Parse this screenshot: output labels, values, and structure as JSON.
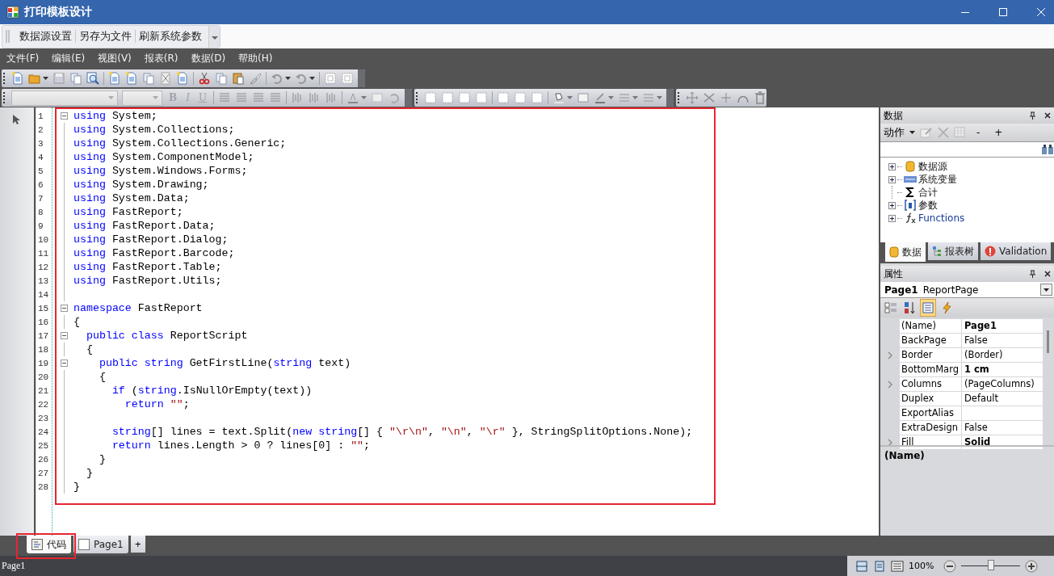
{
  "window": {
    "title": "打印模板设计"
  },
  "quick_toolbar": [
    "数据源设置",
    "另存为文件",
    "刷新系统参数"
  ],
  "menu": [
    "文件(F)",
    "编辑(E)",
    "视图(V)",
    "报表(R)",
    "数据(D)",
    "帮助(H)"
  ],
  "format_buttons": [
    {
      "label": "B",
      "disabled": true
    },
    {
      "label": "I",
      "disabled": true
    },
    {
      "label": "U",
      "disabled": true
    }
  ],
  "code_lines": [
    {
      "number": "1",
      "collapsible": true,
      "tokens": [
        {
          "kind": "keyword",
          "text": "using"
        },
        {
          "kind": "plain",
          "text": " System;"
        }
      ]
    },
    {
      "number": "2",
      "collapsible": false,
      "tokens": [
        {
          "kind": "keyword",
          "text": "using"
        },
        {
          "kind": "plain",
          "text": " System.Collections;"
        }
      ]
    },
    {
      "number": "3",
      "collapsible": false,
      "tokens": [
        {
          "kind": "keyword",
          "text": "using"
        },
        {
          "kind": "plain",
          "text": " System.Collections.Generic;"
        }
      ]
    },
    {
      "number": "4",
      "collapsible": false,
      "tokens": [
        {
          "kind": "keyword",
          "text": "using"
        },
        {
          "kind": "plain",
          "text": " System.ComponentModel;"
        }
      ]
    },
    {
      "number": "5",
      "collapsible": false,
      "tokens": [
        {
          "kind": "keyword",
          "text": "using"
        },
        {
          "kind": "plain",
          "text": " System.Windows.Forms;"
        }
      ]
    },
    {
      "number": "6",
      "collapsible": false,
      "tokens": [
        {
          "kind": "keyword",
          "text": "using"
        },
        {
          "kind": "plain",
          "text": " System.Drawing;"
        }
      ]
    },
    {
      "number": "7",
      "collapsible": false,
      "tokens": [
        {
          "kind": "keyword",
          "text": "using"
        },
        {
          "kind": "plain",
          "text": " System.Data;"
        }
      ]
    },
    {
      "number": "8",
      "collapsible": false,
      "tokens": [
        {
          "kind": "keyword",
          "text": "using"
        },
        {
          "kind": "plain",
          "text": " FastReport;"
        }
      ]
    },
    {
      "number": "9",
      "collapsible": false,
      "tokens": [
        {
          "kind": "keyword",
          "text": "using"
        },
        {
          "kind": "plain",
          "text": " FastReport.Data;"
        }
      ]
    },
    {
      "number": "10",
      "collapsible": false,
      "tokens": [
        {
          "kind": "keyword",
          "text": "using"
        },
        {
          "kind": "plain",
          "text": " FastReport.Dialog;"
        }
      ]
    },
    {
      "number": "11",
      "collapsible": false,
      "tokens": [
        {
          "kind": "keyword",
          "text": "using"
        },
        {
          "kind": "plain",
          "text": " FastReport.Barcode;"
        }
      ]
    },
    {
      "number": "12",
      "collapsible": false,
      "tokens": [
        {
          "kind": "keyword",
          "text": "using"
        },
        {
          "kind": "plain",
          "text": " FastReport.Table;"
        }
      ]
    },
    {
      "number": "13",
      "collapsible": false,
      "tokens": [
        {
          "kind": "keyword",
          "text": "using"
        },
        {
          "kind": "plain",
          "text": " FastReport.Utils;"
        }
      ]
    },
    {
      "number": "14",
      "collapsible": false
    },
    {
      "number": "15",
      "collapsible": true,
      "tokens": [
        {
          "kind": "keyword",
          "text": "namespace"
        },
        {
          "kind": "plain",
          "text": " FastReport"
        }
      ]
    },
    {
      "number": "16",
      "collapsible": false,
      "tokens": [
        {
          "kind": "plain",
          "text": "{"
        }
      ]
    },
    {
      "number": "17",
      "collapsible": true,
      "tokens": [
        {
          "kind": "keyword",
          "text": "  public class"
        },
        {
          "kind": "plain",
          "text": " ReportScript"
        }
      ]
    },
    {
      "number": "18",
      "collapsible": false,
      "tokens": [
        {
          "kind": "plain",
          "text": "  {"
        }
      ]
    },
    {
      "number": "19",
      "collapsible": true,
      "tokens": [
        {
          "kind": "keyword",
          "text": "    public string"
        },
        {
          "kind": "plain",
          "text": " GetFirstLine("
        },
        {
          "kind": "keyword",
          "text": "string"
        },
        {
          "kind": "plain",
          "text": " text)"
        }
      ]
    },
    {
      "number": "20",
      "collapsible": false,
      "tokens": [
        {
          "kind": "plain",
          "text": "    {"
        }
      ]
    },
    {
      "number": "21",
      "collapsible": false,
      "tokens": [
        {
          "kind": "keyword",
          "text": "      if"
        },
        {
          "kind": "plain",
          "text": " ("
        },
        {
          "kind": "keyword",
          "text": "string"
        },
        {
          "kind": "plain",
          "text": ".IsNullOrEmpty(text))"
        }
      ]
    },
    {
      "number": "22",
      "collapsible": false,
      "tokens": [
        {
          "kind": "keyword",
          "text": "        return "
        },
        {
          "kind": "string",
          "text": "\"\""
        },
        {
          "kind": "plain",
          "text": ";"
        }
      ]
    },
    {
      "number": "23",
      "collapsible": false
    },
    {
      "number": "24",
      "collapsible": false,
      "tokens": [
        {
          "kind": "keyword",
          "text": "      string"
        },
        {
          "kind": "plain",
          "text": "[] lines = text.Split("
        },
        {
          "kind": "keyword",
          "text": "new string"
        },
        {
          "kind": "plain",
          "text": "[] { "
        },
        {
          "kind": "string",
          "text": "\"\\r\\n\""
        },
        {
          "kind": "plain",
          "text": ", "
        },
        {
          "kind": "string",
          "text": "\"\\n\""
        },
        {
          "kind": "plain",
          "text": ", "
        },
        {
          "kind": "string",
          "text": "\"\\r\""
        },
        {
          "kind": "plain",
          "text": " }, StringSplitOptions.None);"
        }
      ]
    },
    {
      "number": "25",
      "collapsible": false,
      "tokens": [
        {
          "kind": "keyword",
          "text": "      return"
        },
        {
          "kind": "plain",
          "text": " lines.Length > 0 ? lines[0] : "
        },
        {
          "kind": "string",
          "text": "\"\""
        },
        {
          "kind": "plain",
          "text": ";"
        }
      ]
    },
    {
      "number": "26",
      "collapsible": false,
      "tokens": [
        {
          "kind": "plain",
          "text": "    }"
        }
      ]
    },
    {
      "number": "27",
      "collapsible": false,
      "tokens": [
        {
          "kind": "plain",
          "text": "  }"
        }
      ]
    },
    {
      "number": "28",
      "collapsible": false,
      "tokens": [
        {
          "kind": "plain",
          "text": "}"
        }
      ]
    }
  ],
  "data_panel": {
    "title": "数据",
    "action": "动作",
    "buttons": [
      "-",
      "+"
    ],
    "tree": [
      {
        "label": "数据源",
        "kind": "database",
        "expandable": true
      },
      {
        "label": "系统变量",
        "kind": "variable",
        "expandable": true
      },
      {
        "label": "合计",
        "kind": "sum",
        "expandable": false
      },
      {
        "label": "参数",
        "kind": "parameter",
        "expandable": true
      },
      {
        "label": "Functions",
        "kind": "function",
        "expandable": true
      }
    ],
    "tabs": [
      {
        "label": "数据",
        "kind": "database",
        "selected": true
      },
      {
        "label": "报表树",
        "kind": "tree",
        "selected": false
      },
      {
        "label": "Validation",
        "kind": "warning",
        "selected": false
      }
    ]
  },
  "properties_panel": {
    "title": "属性",
    "object_name": "Page1",
    "object_type": "ReportPage",
    "view_buttons": [
      {
        "kind": "categorized",
        "selected": false
      },
      {
        "kind": "alphabetical",
        "selected": false
      },
      {
        "kind": "properties",
        "selected": true
      },
      {
        "kind": "events",
        "selected": false
      }
    ],
    "rows": [
      {
        "name": "(Name)",
        "value": "Page1",
        "changed": true,
        "expandable": false
      },
      {
        "name": "BackPage",
        "value": "False",
        "changed": false,
        "expandable": false
      },
      {
        "name": "Border",
        "value": "(Border)",
        "changed": false,
        "expandable": true
      },
      {
        "name": "BottomMarg",
        "value": "1 cm",
        "changed": true,
        "expandable": false
      },
      {
        "name": "Columns",
        "value": "(PageColumns)",
        "changed": false,
        "expandable": true
      },
      {
        "name": "Duplex",
        "value": "Default",
        "changed": false,
        "expandable": false
      },
      {
        "name": "ExportAlias",
        "changed": false,
        "expandable": false
      },
      {
        "name": "ExtraDesign",
        "value": "False",
        "changed": false,
        "expandable": false
      },
      {
        "name": "Fill",
        "value": "Solid",
        "changed": true,
        "expandable": true
      }
    ],
    "description": "(Name)"
  },
  "page_tabs": [
    {
      "label": "代码",
      "kind": "code",
      "selected": true
    },
    {
      "label": "Page1",
      "kind": "page",
      "selected": false
    }
  ],
  "add_tab": "+",
  "status_bar": {
    "page": "Page1",
    "zoom": "100%",
    "level": 0.5
  }
}
